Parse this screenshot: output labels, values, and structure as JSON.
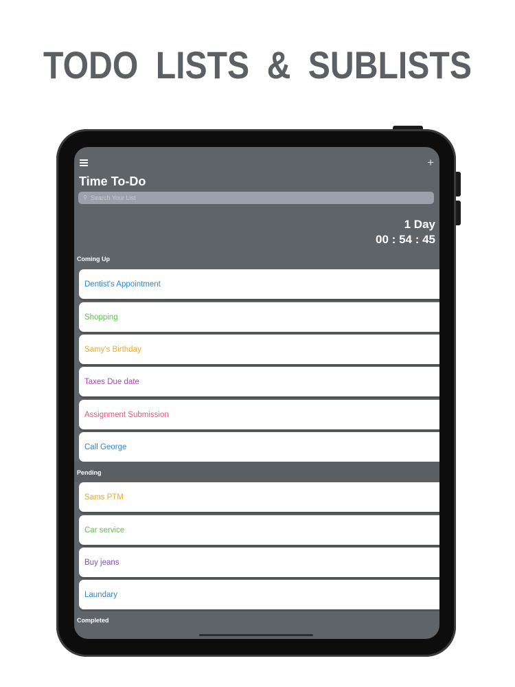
{
  "headline": "TODO LISTS  &  SUBLISTS",
  "app": {
    "title": "Time To-Do",
    "search_placeholder": "Search Your List",
    "countdown": {
      "days": "1 Day",
      "time": "00 : 54 : 45"
    }
  },
  "sections": {
    "coming_up": {
      "label": "Coming Up",
      "items": [
        {
          "label": "Dentist's Appointment",
          "color": "#2f86c6"
        },
        {
          "label": "Shopping",
          "color": "#5fc24a"
        },
        {
          "label": "Samy's Birthday",
          "color": "#f0a92a"
        },
        {
          "label": "Taxes Due date",
          "color": "#b93ab4"
        },
        {
          "label": "Assignment Submission",
          "color": "#e8547a"
        },
        {
          "label": "Call George",
          "color": "#2f86c6"
        }
      ]
    },
    "pending": {
      "label": "Pending",
      "items": [
        {
          "label": "Sams PTM",
          "color": "#f0a92a"
        },
        {
          "label": "Car service",
          "color": "#5fc24a"
        },
        {
          "label": "Buy jeans",
          "color": "#7b4fb3"
        },
        {
          "label": "Laundary",
          "color": "#2f86c6"
        }
      ]
    },
    "completed": {
      "label": "Completed"
    }
  },
  "colors": {
    "screen_bg": "#5f6469",
    "headline": "#5c5f63",
    "device_frame": "#0d0d0d"
  }
}
